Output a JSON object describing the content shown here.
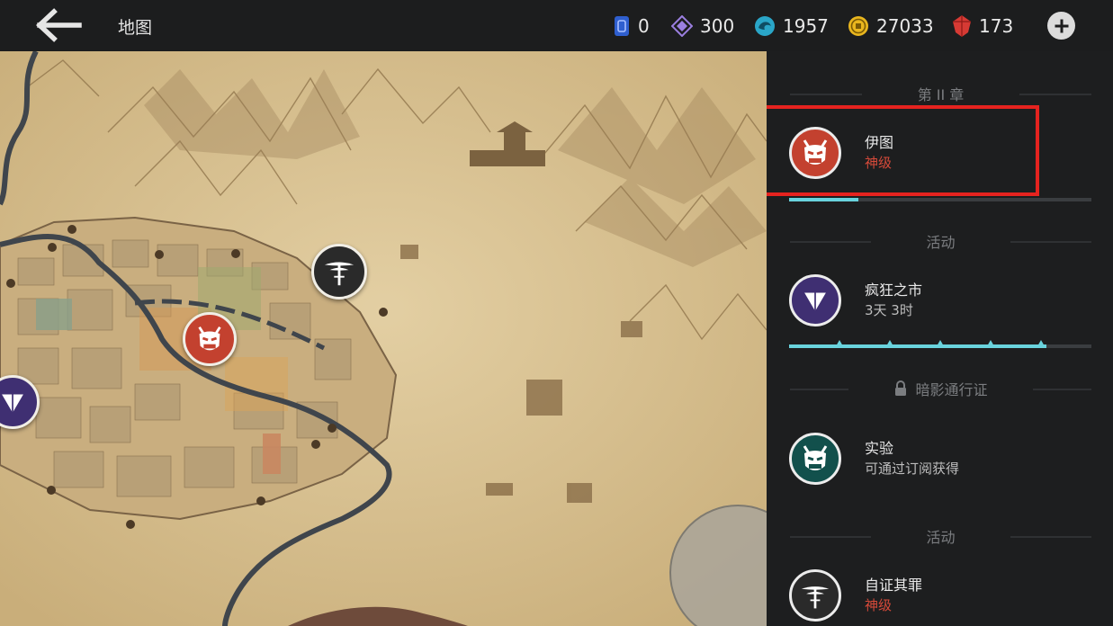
{
  "header": {
    "title": "地图",
    "back_icon": "arrow-left-icon",
    "add_icon": "plus-circle-icon",
    "currencies": [
      {
        "icon": "blue-card-icon",
        "value": "0",
        "color": "#3f6fd1"
      },
      {
        "icon": "purple-diamond-icon",
        "value": "300",
        "color": "#9b7fe0"
      },
      {
        "icon": "teal-swirl-icon",
        "value": "1957",
        "color": "#3ab6d2"
      },
      {
        "icon": "gold-coin-icon",
        "value": "27033",
        "color": "#e9b61e"
      },
      {
        "icon": "red-gem-icon",
        "value": "173",
        "color": "#d63a34"
      }
    ]
  },
  "panel": {
    "sections": [
      {
        "heading": "第 II 章",
        "entries": [
          {
            "name": "伊图",
            "sub": "神级",
            "sub_color": "#d64a3a",
            "icon": "red-oni-mask-icon",
            "icon_bg": "#c3412f",
            "progress": 0.23,
            "highlighted": true
          }
        ]
      },
      {
        "heading": "活动",
        "entries": [
          {
            "name": "疯狂之市",
            "sub": "3天 3时",
            "sub_color": "#bdbdbd",
            "icon": "purple-triangle-icon",
            "icon_bg": "#3f2f72",
            "progress": 0.85,
            "milestones": 5
          }
        ]
      },
      {
        "heading": "暗影通行证",
        "locked": true,
        "entries": [
          {
            "name": "实验",
            "sub": "可通过订阅获得",
            "sub_color": "#bdbdbd",
            "icon": "teal-oni-mask-icon",
            "icon_bg": "#12504c"
          }
        ]
      },
      {
        "heading": "活动",
        "entries": [
          {
            "name": "自证其罪",
            "sub": "神级",
            "sub_color": "#d64a3a",
            "icon": "dragonfly-icon",
            "icon_bg": "#2a2a2a"
          }
        ]
      }
    ]
  },
  "map": {
    "markers": [
      {
        "name": "map-marker-oni-mask",
        "icon": "red-oni-mask-icon",
        "bg": "#c3412f"
      },
      {
        "name": "map-marker-dragonfly",
        "icon": "dragonfly-icon",
        "bg": "#2a2a2a"
      },
      {
        "name": "map-marker-purple-triangle",
        "icon": "purple-triangle-icon",
        "bg": "#3f2f72"
      }
    ]
  }
}
